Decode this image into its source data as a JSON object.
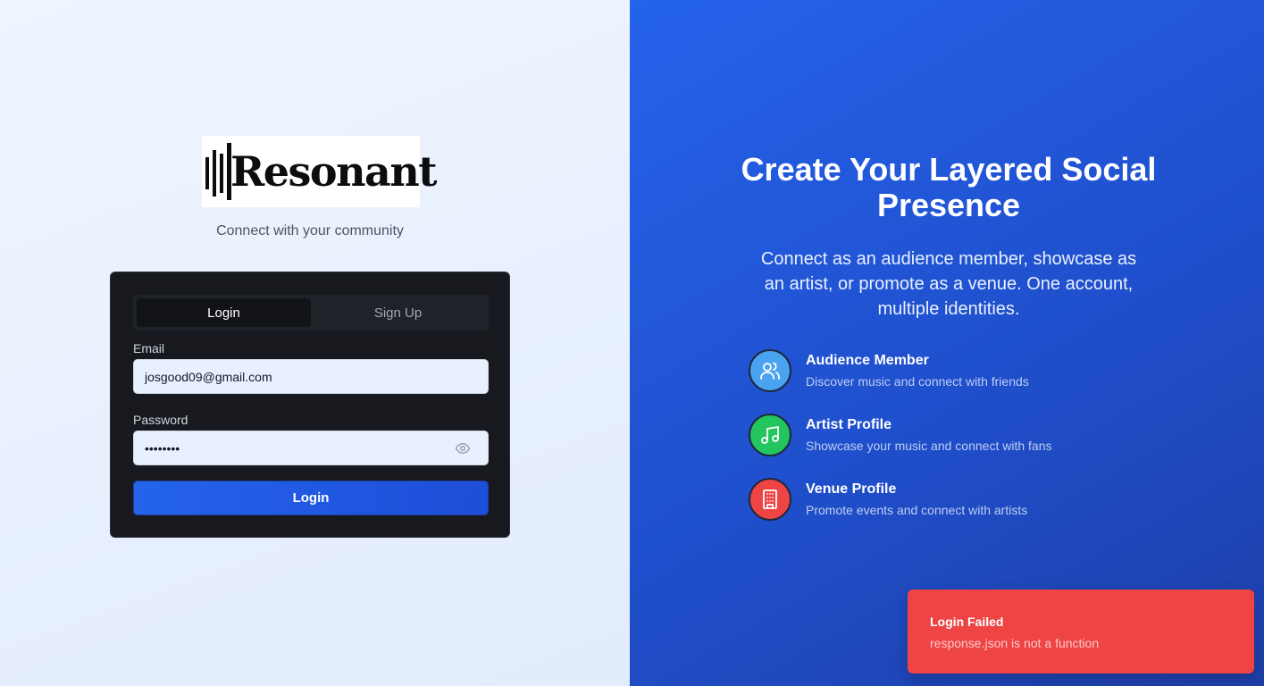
{
  "brand": {
    "name": "Resonant",
    "tagline": "Connect with your community"
  },
  "auth": {
    "tabs": [
      {
        "label": "Login",
        "active": true
      },
      {
        "label": "Sign Up",
        "active": false
      }
    ],
    "email": {
      "label": "Email",
      "value": "josgood09@gmail.com"
    },
    "password": {
      "label": "Password",
      "value": "••••••••"
    },
    "submit_label": "Login"
  },
  "hero": {
    "title": "Create Your Layered Social Presence",
    "subtitle": "Connect as an audience member, showcase as an artist, or promote as a venue. One account, multiple identities.",
    "features": [
      {
        "title": "Audience Member",
        "description": "Discover music and connect with friends",
        "icon": "users-icon",
        "color": "#4aa3f0"
      },
      {
        "title": "Artist Profile",
        "description": "Showcase your music and connect with fans",
        "icon": "music-note-icon",
        "color": "#22c55e"
      },
      {
        "title": "Venue Profile",
        "description": "Promote events and connect with artists",
        "icon": "building-icon",
        "color": "#ef4444"
      }
    ]
  },
  "toast": {
    "title": "Login Failed",
    "message": "response.json is not a function",
    "color": "#ef4444"
  }
}
